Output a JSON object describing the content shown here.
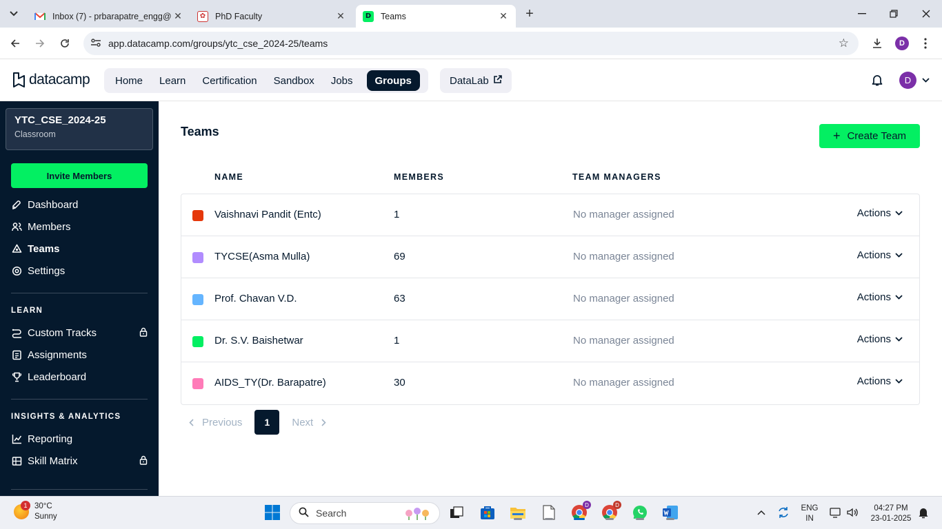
{
  "browser": {
    "tabs": [
      {
        "title": "Inbox (7) - prbarapatre_engg@",
        "icon": "gmail-icon"
      },
      {
        "title": "PhD Faculty",
        "icon": "college-icon"
      },
      {
        "title": "Teams",
        "icon": "datacamp-icon"
      }
    ],
    "url": "app.datacamp.com/groups/ytc_cse_2024-25/teams",
    "profile_initial": "D"
  },
  "header": {
    "logo_text": "datacamp",
    "nav": [
      "Home",
      "Learn",
      "Certification",
      "Sandbox",
      "Jobs",
      "Groups"
    ],
    "active_nav": "Groups",
    "datalab": "DataLab",
    "user_initial": "D"
  },
  "sidebar": {
    "group_name": "YTC_CSE_2024-25",
    "group_type": "Classroom",
    "invite_label": "Invite Members",
    "items": [
      "Dashboard",
      "Members",
      "Teams",
      "Settings"
    ],
    "learn_heading": "LEARN",
    "learn_items": [
      "Custom Tracks",
      "Assignments",
      "Leaderboard"
    ],
    "insights_heading": "INSIGHTS & ANALYTICS",
    "insights_items": [
      "Reporting",
      "Skill Matrix"
    ]
  },
  "main": {
    "title": "Teams",
    "create_label": "Create Team",
    "columns": [
      "NAME",
      "MEMBERS",
      "TEAM MANAGERS"
    ],
    "teams": [
      {
        "name": "Vaishnavi Pandit (Entc)",
        "members": "1",
        "manager": "No manager assigned",
        "color": "#e5380b",
        "action": "Actions"
      },
      {
        "name": "TYCSE(Asma Mulla)",
        "members": "69",
        "manager": "No manager assigned",
        "color": "#b18cfe",
        "action": "Actions"
      },
      {
        "name": "Prof. Chavan V.D.",
        "members": "63",
        "manager": "No manager assigned",
        "color": "#65b5ff",
        "action": "Actions"
      },
      {
        "name": "Dr. S.V. Baishetwar",
        "members": "1",
        "manager": "No manager assigned",
        "color": "#03ef62",
        "action": "Actions"
      },
      {
        "name": "AIDS_TY(Dr. Barapatre)",
        "members": "30",
        "manager": "No manager assigned",
        "color": "#ff7bb8",
        "action": "Actions"
      }
    ],
    "pagination": {
      "prev": "Previous",
      "page": "1",
      "next": "Next"
    }
  },
  "taskbar": {
    "temp": "30°C",
    "condition": "Sunny",
    "weather_badge": "1",
    "search_placeholder": "Search",
    "lang": "ENG",
    "region": "IN",
    "time": "04:27 PM",
    "date": "23-01-2025"
  }
}
